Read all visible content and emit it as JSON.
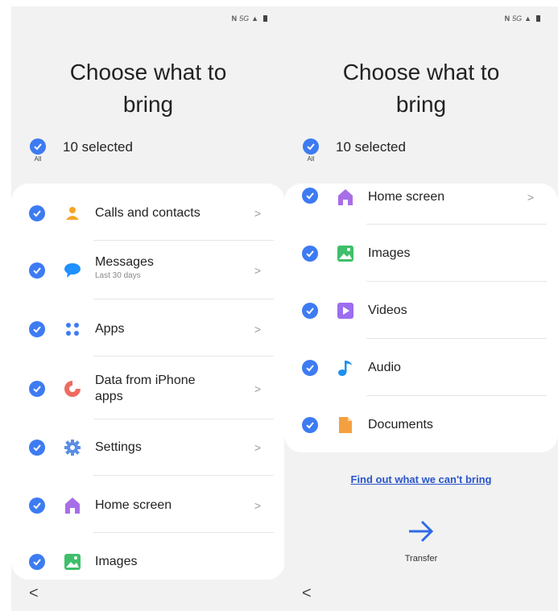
{
  "status": {
    "nfc": "N",
    "network": "5G",
    "signal": "▲"
  },
  "title": "Choose what to bring",
  "selected": {
    "count_text": "10 selected",
    "all_label": "All"
  },
  "left_items": [
    {
      "label": "Calls and contacts",
      "sub": "",
      "icon": "person-icon",
      "color": "#f5a623"
    },
    {
      "label": "Messages",
      "sub": "Last 30 days",
      "icon": "chat-bubble-icon",
      "color": "#1e90ff"
    },
    {
      "label": "Apps",
      "sub": "",
      "icon": "apps-grid-icon",
      "color": "#3d7bf2"
    },
    {
      "label": "Data from iPhone apps",
      "sub": "",
      "icon": "pie-chart-icon",
      "color": "#ef6b62"
    },
    {
      "label": "Settings",
      "sub": "",
      "icon": "gear-icon",
      "color": "#5a8de6"
    },
    {
      "label": "Home screen",
      "sub": "",
      "icon": "home-icon",
      "color": "#a86ee8"
    },
    {
      "label": "Images",
      "sub": "",
      "icon": "image-icon",
      "color": "#3fbf6a"
    }
  ],
  "right_items": [
    {
      "label": "Home screen",
      "icon": "home-icon",
      "color": "#a86ee8"
    },
    {
      "label": "Images",
      "icon": "image-icon",
      "color": "#3fbf6a"
    },
    {
      "label": "Videos",
      "icon": "play-icon",
      "color": "#9b6df0"
    },
    {
      "label": "Audio",
      "icon": "music-note-icon",
      "color": "#1e8ff0"
    },
    {
      "label": "Documents",
      "icon": "document-icon",
      "color": "#f5a040"
    }
  ],
  "link": "Find out what we can't bring",
  "transfer": "Transfer",
  "nav": {
    "back": "<"
  },
  "colors": {
    "accent": "#3d7bf2",
    "link": "#2a55c9",
    "background": "#f2f2f2"
  }
}
